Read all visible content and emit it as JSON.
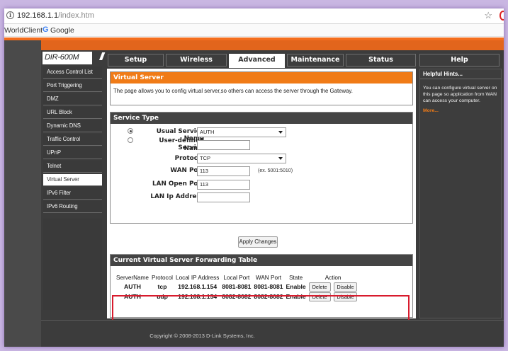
{
  "browser": {
    "url_host": "192.168.1.1",
    "url_path": "/index.htm",
    "bookmarks": [
      "WorldClient",
      "Google"
    ]
  },
  "router": {
    "model": "DIR-600M",
    "tabs": [
      "Setup",
      "Wireless",
      "Advanced",
      "Maintenance",
      "Status",
      "Help"
    ],
    "active_tab": "Advanced",
    "sidebar": [
      "Access Control List",
      "Port Triggering",
      "DMZ",
      "URL Block",
      "Dynamic DNS",
      "Traffic Control",
      "UPnP",
      "Telnet",
      "Virtual Server",
      "IPv6 Filter",
      "IPv6 Routing"
    ],
    "active_sidebar": "Virtual Server"
  },
  "virtual_server": {
    "title": "Virtual Server",
    "description": "The page allows you to config virtual server,so others can access the server through the Gateway."
  },
  "service_type": {
    "title": "Service Type",
    "usual_label": "Usual Service Name",
    "usual_value": "AUTH",
    "user_defined_label_1": "User-defined Service",
    "user_defined_label_2": "Name",
    "user_defined_value": "",
    "protocol_label": "Protocol",
    "protocol_value": "TCP",
    "wan_port_label": "WAN Port",
    "wan_port_value": "113",
    "wan_port_hint": "(ex. 5001:5010)",
    "lan_port_label": "LAN Open Port",
    "lan_port_value": "113",
    "lan_ip_label": "LAN Ip Address",
    "lan_ip_value": "",
    "apply_label": "Apply Changes"
  },
  "forwarding_table": {
    "title": "Current Virtual Server Forwarding Table",
    "headers": [
      "ServerName",
      "Protocol",
      "Local IP Address",
      "Local Port",
      "WAN Port",
      "State",
      "Action"
    ],
    "rows": [
      {
        "name": "AUTH",
        "protocol": "tcp",
        "ip": "192.168.1.154",
        "local_port": "8081-8081",
        "wan_port": "8081-8081",
        "state": "Enable",
        "delete": "Delete",
        "disable": "Disable"
      },
      {
        "name": "AUTH",
        "protocol": "udp",
        "ip": "192.168.1.154",
        "local_port": "8082-8082",
        "wan_port": "8082-8082",
        "state": "Enable",
        "delete": "Delete",
        "disable": "Disable"
      }
    ]
  },
  "help": {
    "title": "Helpful Hints...",
    "text": "You can configure virtual server on this page so application from WAN can access your computer.",
    "more": "More..."
  },
  "footer": {
    "copyright": "Copyright © 2008-2013 D-Link Systems, Inc."
  },
  "colors": {
    "accent": "#f07b17",
    "highlight": "#d81b2d",
    "dark": "#3c3c3c"
  }
}
